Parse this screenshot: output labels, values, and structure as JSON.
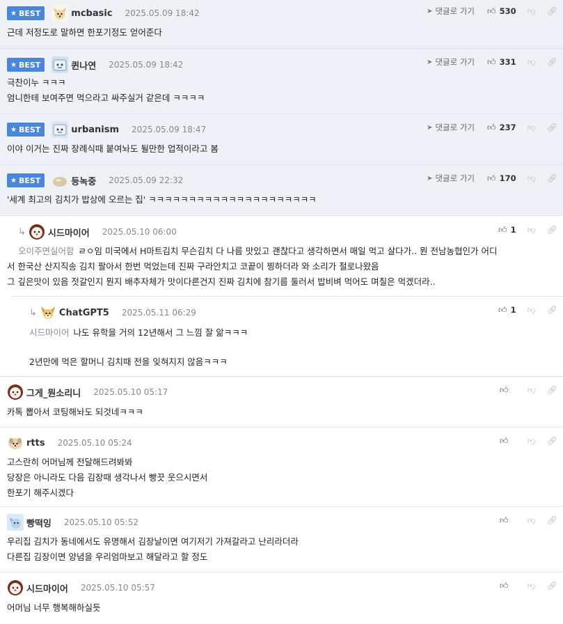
{
  "labels": {
    "best": "BEST",
    "goto_reply": "댓글로 가기"
  },
  "icons": {
    "star": "star-icon",
    "send": "send-arrow-icon",
    "thumb_up": "thumbs-up-icon",
    "thumb_down": "thumbs-down-icon",
    "link": "link-icon",
    "reply": "reply-arrow-icon"
  },
  "colors": {
    "best_badge": "#4a86d9",
    "best_bg": "#eef2f7",
    "mention": "#8a8a8a"
  },
  "comments": [
    {
      "best": true,
      "nick": "mcbasic",
      "date": "2025.05.09 18:42",
      "likes": "530",
      "lines": [
        "근데 저정도로 말하면 한포기정도 얻어준다"
      ]
    },
    {
      "best": true,
      "nick": "퀸나연",
      "date": "2025.05.09 18:42",
      "likes": "331",
      "lines": [
        "극찬이누 ㅋㅋㅋ",
        "엄니한테 보여주면 먹으라고 싸주실거 같은데 ㅋㅋㅋㅋ"
      ]
    },
    {
      "best": true,
      "nick": "urbanism",
      "date": "2025.05.09 18:47",
      "likes": "237",
      "lines": [
        "이야 이거는 진짜 장례식때 붙여놔도 될만한 업적이라고 봄"
      ]
    },
    {
      "best": true,
      "nick": "등녹중",
      "date": "2025.05.09 22:32",
      "likes": "170",
      "lines": [
        "'세계 최고의 김치가 밥상에 오르는 집' ㅋㅋㅋㅋㅋㅋㅋㅋㅋㅋㅋㅋㅋㅋㅋㅋㅋㅋㅋㅋㅋ"
      ]
    },
    {
      "best": false,
      "nick": "시드마이어",
      "date": "2025.05.10 06:00",
      "likes": "1",
      "mention": "오이주면실어함",
      "lines": [
        "ㄹㅇ임 미국에서 H마트김치 무슨김치 다 나름 맛있고 괜찮다고 생각하면서 매일 먹고 살다가.. 뭔 전남농협인가 어디",
        "서 한국산 산지직송 김치 팔아서 한번 먹었는데 진짜 구라안치고 코끝이 찡하더라 와 소리가 절로나왔음",
        "그 깊은맛이 있음 젓갈인지 뭔지 배추자체가 맛이다른건지 진짜 김치에 참기름 둘러서 밥비벼 먹어도 며칠은 먹겠더라.."
      ]
    },
    {
      "best": false,
      "nick": "ChatGPT5",
      "date": "2025.05.11 06:29",
      "likes": "1",
      "mention": "시드마이어",
      "lines": [
        "나도 유학을 거의 12년해서 그 느낌 잘 앎ㅋㅋㅋ",
        "",
        "2년만에 먹은 할머니 김치때 전을 잊혀지지 않음ㅋㅋㅋ"
      ]
    },
    {
      "best": false,
      "nick": "그게_뭔소리니",
      "date": "2025.05.10 05:17",
      "likes": "",
      "lines": [
        "카톡 뽑아서 코팅해놔도 되것네ㅋㅋㅋ"
      ]
    },
    {
      "best": false,
      "nick": "rtts",
      "date": "2025.05.10 05:24",
      "likes": "",
      "lines": [
        "고스란히 어머님께 전달해드려봐봐",
        "당장은 아니라도 다음 김장때 생각나서 빵끗 웃으시면서",
        "한포기 해주시겠다"
      ]
    },
    {
      "best": false,
      "nick": "빵떡잉",
      "date": "2025.05.10 05:52",
      "likes": "",
      "lines": [
        "우리집 김치가 동네에서도 유명해서 김장날이면 여기저기 가져갈라고 난리라더라",
        "다른집 김장이면 양념을 우리엄마보고 해달라고 할 정도"
      ]
    },
    {
      "best": false,
      "nick": "시드마이어",
      "date": "2025.05.10 05:57",
      "likes": "",
      "lines": [
        "어머님 너무 행복해하실듯"
      ]
    }
  ]
}
